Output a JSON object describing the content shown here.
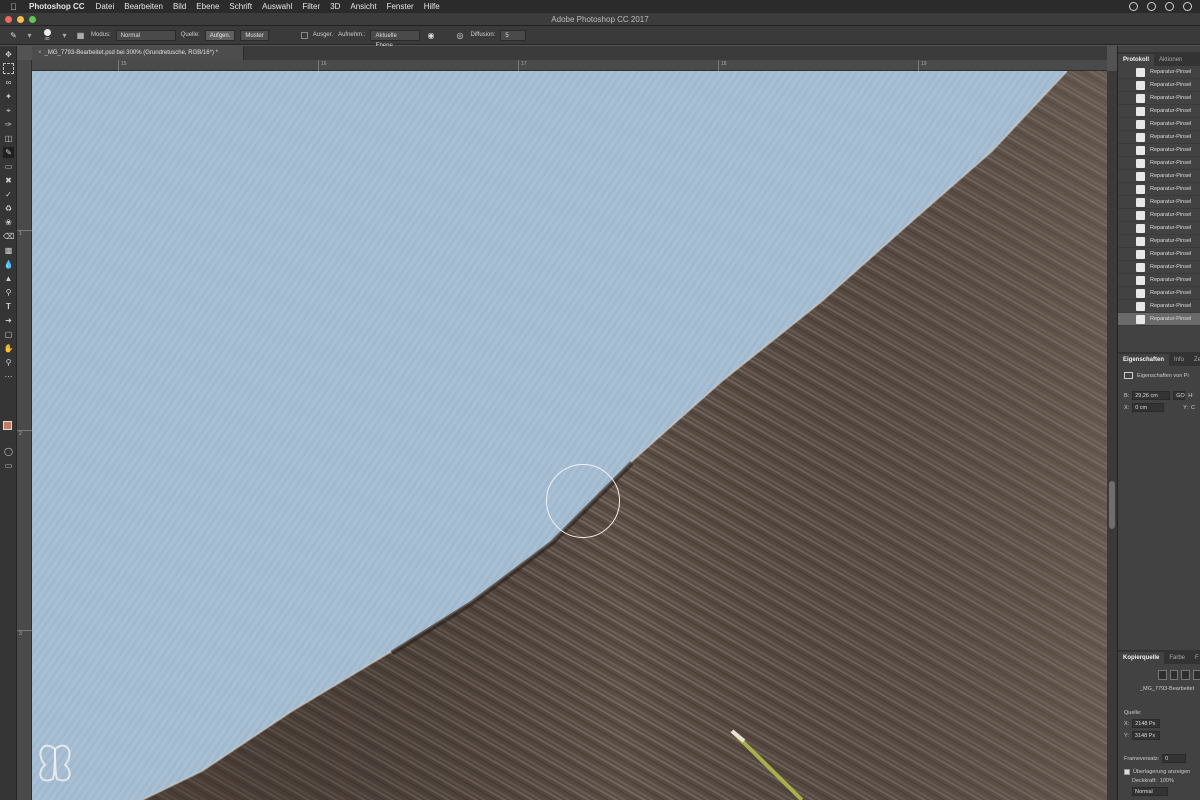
{
  "menubar": {
    "app_name": "Photoshop CC",
    "items": [
      "Datei",
      "Bearbeiten",
      "Bild",
      "Ebene",
      "Schrift",
      "Auswahl",
      "Filter",
      "3D",
      "Ansicht",
      "Fenster",
      "Hilfe"
    ]
  },
  "window": {
    "title": "Adobe Photoshop CC 2017"
  },
  "options_bar": {
    "brush_size": "40",
    "mode_label": "Modus:",
    "mode_value": "Normal",
    "source_label": "Quelle:",
    "source_sampled": "Aufgen.",
    "source_pattern": "Muster",
    "aligned_label": "Ausger.",
    "sample_label": "Aufnehm.:",
    "sample_value": "Aktuelle Ebene",
    "diffusion_label": "Diffusion:",
    "diffusion_value": "5"
  },
  "document": {
    "tab_title": "_MG_7793-Bearbeitet.psd bei 300% (Grundretusche, RGB/16*) *"
  },
  "rulers": {
    "h_ticks": [
      "15",
      "16",
      "17",
      "18",
      "19"
    ],
    "v_ticks": [
      "1",
      "2",
      "3"
    ]
  },
  "history_panel": {
    "tabs": [
      "Protokoll",
      "Aktionen"
    ],
    "items": [
      "Reparatur-Pinsel",
      "Reparatur-Pinsel",
      "Reparatur-Pinsel",
      "Reparatur-Pinsel",
      "Reparatur-Pinsel",
      "Reparatur-Pinsel",
      "Reparatur-Pinsel",
      "Reparatur-Pinsel",
      "Reparatur-Pinsel",
      "Reparatur-Pinsel",
      "Reparatur-Pinsel",
      "Reparatur-Pinsel",
      "Reparatur-Pinsel",
      "Reparatur-Pinsel",
      "Reparatur-Pinsel",
      "Reparatur-Pinsel",
      "Reparatur-Pinsel",
      "Reparatur-Pinsel",
      "Reparatur-Pinsel",
      "Reparatur-Pinsel"
    ],
    "selected_index": 19
  },
  "properties_panel": {
    "tabs": [
      "Eigenschaften",
      "Info",
      "Ze"
    ],
    "heading": "Eigenschaften von Pi",
    "width_label": "B:",
    "width_value": "29,26 cm",
    "link_label": "GO",
    "height_label": "H:",
    "x_label": "X:",
    "x_value": "0 cm",
    "y_label": "Y:",
    "y_value": "C"
  },
  "clone_source_panel": {
    "tabs": [
      "Kopierquelle",
      "Farbe",
      "F"
    ],
    "source_file": "_MG_7793-Bearbeitet",
    "source_label": "Quelle:",
    "x_label": "X:",
    "x_value": "2148 Px",
    "y_label": "Y:",
    "y_value": "3148 Px",
    "frame_offset_label": "Frameversatz:",
    "frame_offset_value": "0",
    "show_overlay_label": "Überlagerung anzeigen",
    "opacity_label": "Deckkraft:",
    "opacity_value": "100%",
    "blend_value": "Normal"
  },
  "colors": {
    "foreground": "#c47a66",
    "background": "#111111",
    "menu_bg": "#2b2b2b",
    "panel_bg": "#424242"
  }
}
